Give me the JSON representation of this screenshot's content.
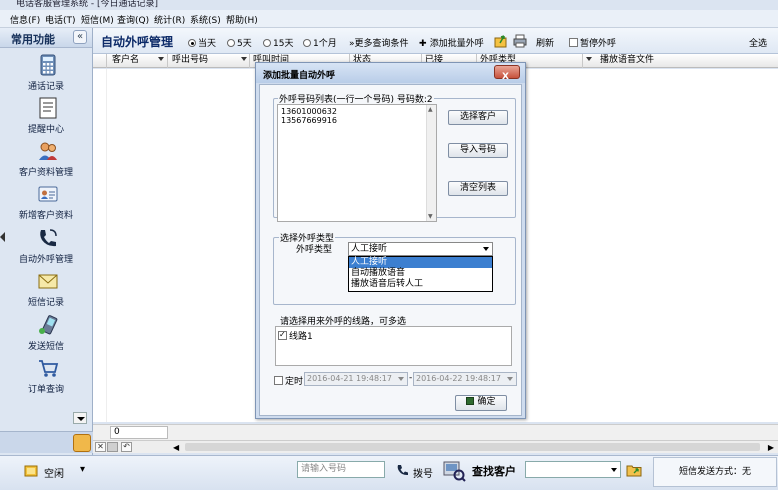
{
  "window": {
    "title": "电话客服管理系统 - [今日通话记录]"
  },
  "menu": [
    "信息(F)",
    "电话(T)",
    "短信(M)",
    "查询(Q)",
    "统计(R)",
    "系统(S)",
    "帮助(H)"
  ],
  "sidebar": {
    "header": "常用功能",
    "items": [
      {
        "label": "通话记录",
        "icon": "calculator-icon"
      },
      {
        "label": "提醒中心",
        "icon": "notepad-icon"
      },
      {
        "label": "客户资料管理",
        "icon": "customers-icon"
      },
      {
        "label": "新增客户资料",
        "icon": "contact-card-icon"
      },
      {
        "label": "自动外呼管理",
        "icon": "phone-icon"
      },
      {
        "label": "短信记录",
        "icon": "envelope-icon"
      },
      {
        "label": "发送短信",
        "icon": "mobile-phone-icon"
      },
      {
        "label": "订单查询",
        "icon": "cart-icon"
      }
    ]
  },
  "toolbar": {
    "title": "自动外呼管理",
    "period_options": [
      {
        "label": "当天",
        "selected": true
      },
      {
        "label": "5天",
        "selected": false
      },
      {
        "label": "15天",
        "selected": false
      },
      {
        "label": "1个月",
        "selected": false
      }
    ],
    "more_query": "更多查询条件",
    "add_batch": "添加批量外呼",
    "refresh": "刷新",
    "pause": "暂停外呼",
    "select_all": "全选"
  },
  "grid": {
    "columns": [
      "客户名",
      "呼出号码",
      "呼叫时间",
      "状态",
      "已接",
      "外呼类型",
      "播放语音文件"
    ],
    "sum_value": "0"
  },
  "status_bar": {
    "state": "空闲",
    "phone_placeholder": "请输入号码",
    "dial": "拨号",
    "find_customer": "查找客户",
    "sms_mode": "短信发送方式：无"
  },
  "dialog": {
    "title": "添加批量自动外呼",
    "close": "X",
    "list_label": "外呼号码列表(一行一个号码)  号码数:2",
    "numbers": [
      "13601000632",
      "13567669916"
    ],
    "btn_select_customer": "选择客户",
    "btn_import": "导入号码",
    "btn_clear": "清空列表",
    "calltype_group": "选择外呼类型",
    "calltype_label": "外呼类型",
    "calltype_value": "人工接听",
    "calltype_options": [
      "人工接听",
      "自动播放语音",
      "播放语音后转人工"
    ],
    "lines_label": "请选择用来外呼的线路，可多选",
    "lines": [
      {
        "label": "线路1",
        "checked": true
      }
    ],
    "timed_label": "定时",
    "start_time": "2016-04-21 19:48:17",
    "end_time": "2016-04-22 19:48:17",
    "confirm": "确定"
  }
}
